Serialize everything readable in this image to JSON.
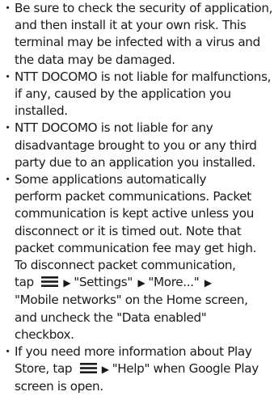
{
  "bullet_symbol": "・",
  "arrow_symbol": "▶",
  "items": [
    {
      "lines": [
        "Be sure to check the security of application,",
        "and then install it at your own risk. This",
        "terminal may be infected with a virus and",
        "the data may be damaged."
      ]
    },
    {
      "lines": [
        "NTT DOCOMO is not liable for malfunctions,",
        "if any, caused by the application you",
        "installed."
      ]
    },
    {
      "lines": [
        "NTT DOCOMO is not liable for any",
        "disadvantage brought to you or any third",
        "party due to an application you installed."
      ]
    },
    {
      "lines": [
        "Some applications automatically",
        "perform packet communications. Packet",
        "communication is kept active unless you",
        "disconnect or it is timed out. Note that",
        "packet communication fee may get high.",
        "To disconnect packet communication,"
      ],
      "line7": {
        "prefix": "tap",
        "settings": "\"Settings\"",
        "more": "\"More...\""
      },
      "line8": "\"Mobile networks\" on the Home screen,",
      "line9": "and uncheck the \"Data enabled\"",
      "line10": "checkbox."
    },
    {
      "line1": "If you need more information about Play",
      "line2": {
        "prefix": "Store, tap",
        "help": "\"Help\" when Google Play"
      },
      "line3": "screen is open."
    }
  ],
  "icons": {
    "menu": "menu-icon",
    "arrow": "arrow-right-icon"
  }
}
